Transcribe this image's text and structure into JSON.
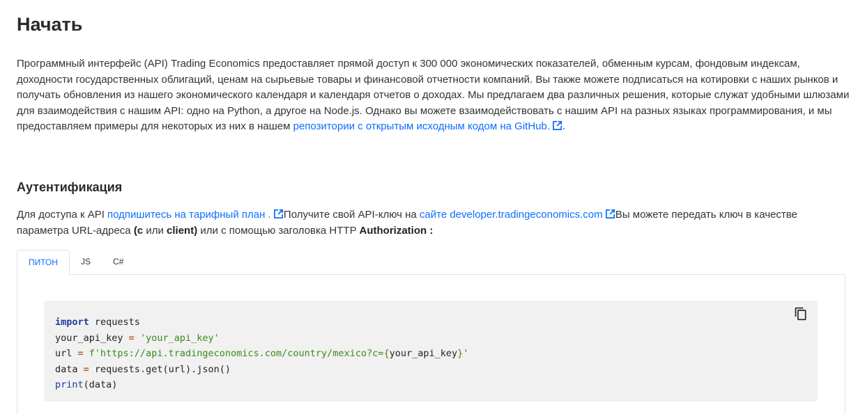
{
  "page_title": "Начать",
  "intro": {
    "text_before_link": "Программный интерфейс (API) Trading Economics предоставляет прямой доступ к 300 000 экономических показателей, обменным курсам, фондовым индексам, доходности государственных облигаций, ценам на сырьевые товары и финансовой отчетности компаний. Вы также можете подписаться на котировки с наших рынков и получать обновления из нашего экономического календаря и календаря отчетов о доходах. Мы предлагаем два различных решения, которые служат удобными шлюзами для взаимодействия с нашим API: одно на Python, а другое на Node.js. Однако вы можете взаимодействовать с нашим API на разных языках программирования, и мы предоставляем примеры для некоторых из них в нашем ",
    "link_text": "репозитории с открытым исходным кодом на GitHub.",
    "text_after_link": "."
  },
  "auth": {
    "heading": "Аутентификация",
    "t1": "Для доступа к API ",
    "link1": "подпишитесь на тарифный план .",
    "t2": "Получите свой API-ключ на ",
    "link2": "сайте developer.tradingeconomics.com",
    "t3": "Вы можете передать ключ в качестве параметра URL-адреса ",
    "b1": "(c",
    "t4": " или ",
    "b2": "client)",
    "t5": " или с помощью заголовка HTTP ",
    "b3": "Authorization :"
  },
  "tabs": [
    {
      "label": "ПИТОН",
      "active": true
    },
    {
      "label": "JS",
      "active": false
    },
    {
      "label": "C#",
      "active": false
    }
  ],
  "code": {
    "l1_kw": "import",
    "l1_rest": " requests",
    "l2_var": "your_api_key ",
    "l2_op": "=",
    "l2_str": " 'your_api_key'",
    "l3_var": "url ",
    "l3_op": "=",
    "l3_str1": " f'https://api.tradingeconomics.com/country/mexico?c=",
    "l3_brace1": "{",
    "l3_inner": "your_api_key",
    "l3_brace2": "}",
    "l3_str2": "'",
    "l4_var": "data ",
    "l4_op": "=",
    "l4_obj": " requests",
    "l4_dot": ".",
    "l4_rest": "get(url).json()",
    "l5_fn": "print",
    "l5_rest": "(data)"
  },
  "icons": {
    "external_link": "external-link-icon",
    "copy": "copy-icon"
  },
  "colors": {
    "link": "#0d6efd",
    "code_bg": "#f1f1f1"
  }
}
